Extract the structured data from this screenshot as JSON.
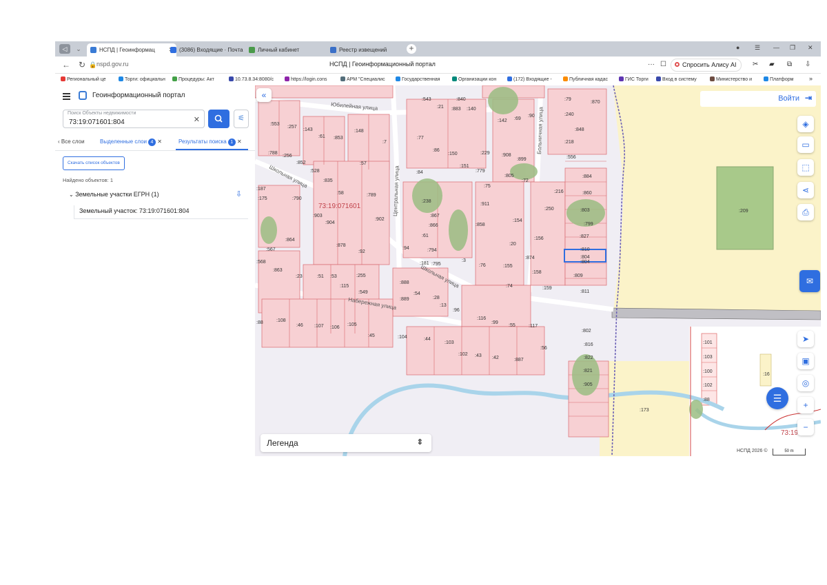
{
  "browser": {
    "tabs": [
      {
        "label": "НСПД | Геоинформац",
        "active": true
      },
      {
        "label": "(3086) Входящие · Почта"
      },
      {
        "label": "Личный кабинет"
      },
      {
        "label": "Реестр извещений"
      }
    ],
    "url": "nspd.gov.ru",
    "page_title": "НСПД | Геоинформационный портал",
    "alice_label": "Спросить Алису AI",
    "bookmarks": [
      "Региональный це",
      "Торги: официальн",
      "Процедуры: Акт",
      "10.73.8.34:8080/c",
      "https://login.cons",
      "АРМ \"Специалис",
      "Государственная",
      "Организации кон",
      "(172) Входящие -",
      "Публичная кадас",
      "ГИС Торги",
      "Вход в систему",
      "Министерство и",
      "Платформ"
    ]
  },
  "panel": {
    "title": "Геоинформационный портал",
    "search": {
      "label": "Поиск Объекты недвижимости",
      "value": "73:19:071601:804"
    },
    "tabs": [
      {
        "label": "Все слои"
      },
      {
        "label": "Выделенные слои",
        "badge": "4"
      },
      {
        "label": "Результаты поиска",
        "badge": "1",
        "active": true
      }
    ],
    "download_label": "Скачать список объектов",
    "found_text": "Найдено объектов: 1",
    "group_label": "Земельные участки ЕГРН (1)",
    "result_item": "Земельный участок: 73:19:071601:804"
  },
  "map": {
    "login_label": "Войти",
    "legend_label": "Легенда",
    "copyright": "НСПД 2026 ©",
    "scale_label": "50 m",
    "cadastral_quarter": "73:19:071601",
    "cadastral_quarter_right": "73:19",
    "streets": [
      "Юбилейная улица",
      "Школьная улица",
      "Центральная улица",
      "Больничная улица",
      "Набережная улица"
    ],
    "parcel_labels": [
      ":840",
      ":543",
      ":21",
      ":883",
      ":140",
      ":79",
      ":870",
      ":553",
      ":257",
      ":143",
      ":61",
      ":853",
      ":148",
      ":142",
      ":69",
      ":90",
      ":240",
      ":848",
      ":788",
      ":256",
      ":852",
      ":7",
      ":77",
      ":86",
      ":150",
      ":229",
      ":908",
      ":899",
      ":218",
      ":556",
      ":187",
      ":528",
      ":835",
      ":57",
      ":84",
      ":151",
      ":779",
      ":805",
      ":72",
      ":884",
      ":175",
      ":790",
      ":58",
      ":789",
      ":75",
      ":216",
      ":860",
      ":903",
      ":904",
      ":902",
      ":238",
      ":911",
      ":250",
      ":803",
      ":867",
      ":866",
      ":858",
      ":154",
      ":799",
      ":864",
      ":878",
      ":61",
      ":156",
      ":827",
      ":567",
      ":92",
      ":94",
      ":794",
      ":20",
      ":810",
      ":568",
      ":863",
      ":181",
      ":795",
      ":3",
      ":76",
      ":155",
      ":874",
      ":804",
      ":23",
      ":51",
      ":53",
      ":255",
      ":888",
      ":158",
      ":809",
      ":115",
      ":549",
      ":54",
      ":28",
      ":74",
      ":159",
      ":811",
      ":889",
      ":13",
      ":96",
      ":88",
      ":108",
      ":46",
      ":107",
      ":106",
      ":105",
      ":116",
      ":99",
      ":55",
      ":117",
      ":802",
      ":45",
      ":104",
      ":44",
      ":103",
      ":56",
      ":816",
      ":102",
      ":43",
      ":42",
      ":887",
      ":822",
      ":821",
      ":905",
      ":209",
      ":101",
      ":103",
      ":100",
      ":102",
      ":88",
      ":16",
      ":173"
    ],
    "selected_parcel": ":804"
  }
}
